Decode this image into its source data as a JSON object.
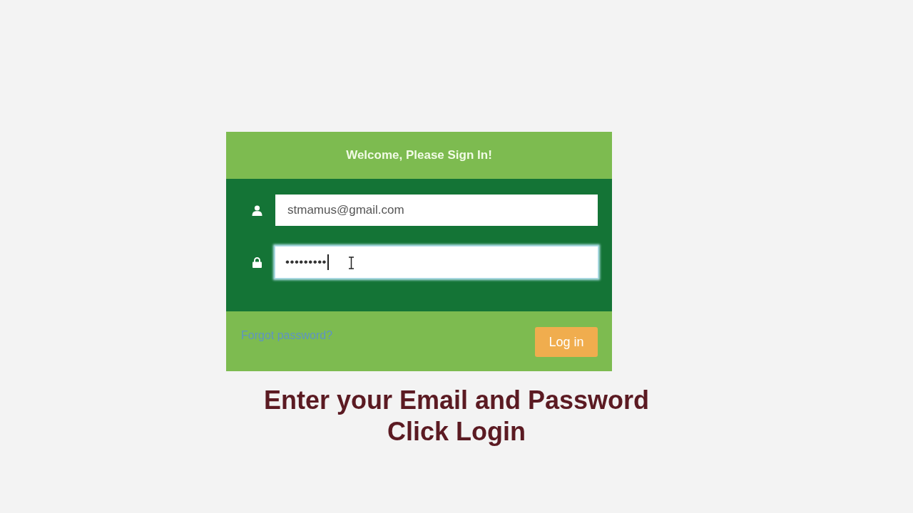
{
  "header": {
    "title": "Welcome, Please Sign In!"
  },
  "fields": [
    {
      "kind": "email",
      "value": "stmamus@gmail.com",
      "focused": false
    },
    {
      "kind": "password",
      "value": "•••••••••",
      "focused": true
    }
  ],
  "footer": {
    "forgot_link": "Forgot password?",
    "login_button": "Log in"
  },
  "caption": [
    "Enter your Email and Password",
    "Click Login"
  ]
}
